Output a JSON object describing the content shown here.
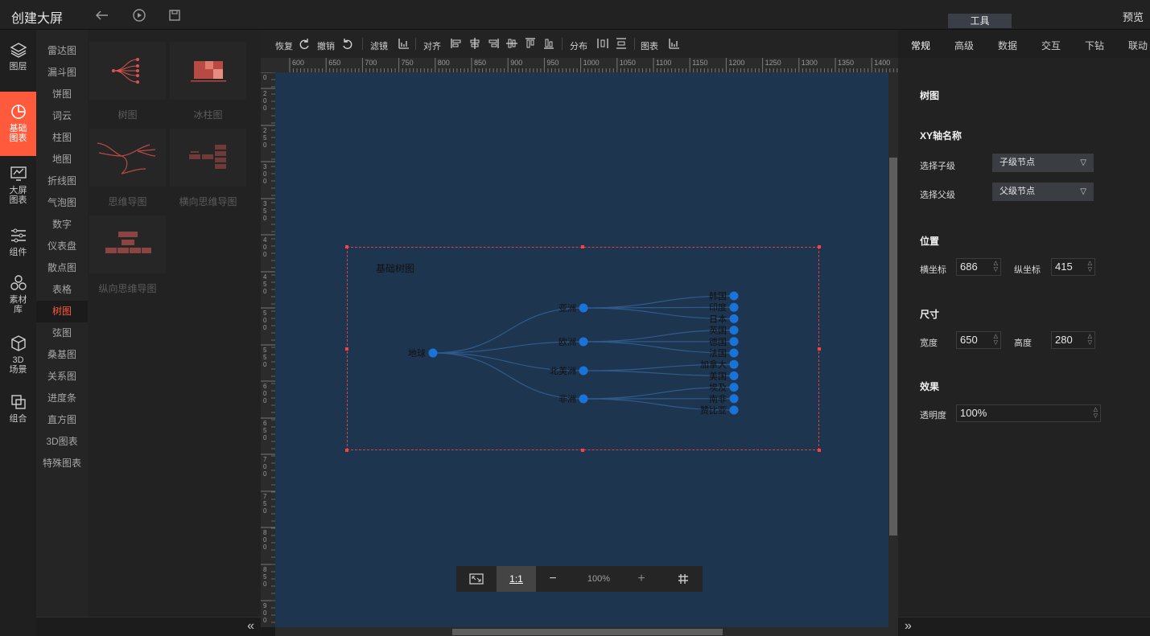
{
  "app": {
    "title": "创建大屏",
    "preview": "预览",
    "tools_tab": "工具"
  },
  "rail": [
    {
      "label": "图层",
      "icon": "layers-icon"
    },
    {
      "label": "基础\n图表",
      "icon": "pie-chart-icon",
      "active": true
    },
    {
      "label": "大屏\n图表",
      "icon": "screen-chart-icon"
    },
    {
      "label": "组件",
      "icon": "sliders-icon"
    },
    {
      "label": "素材\n库",
      "icon": "hexagons-icon"
    },
    {
      "label": "3D\n场景",
      "icon": "cube-icon"
    },
    {
      "label": "组合",
      "icon": "group-icon"
    }
  ],
  "menu2": [
    "雷达图",
    "漏斗图",
    "饼图",
    "词云",
    "柱图",
    "地图",
    "折线图",
    "气泡图",
    "数字",
    "仪表盘",
    "散点图",
    "表格",
    "树图",
    "弦图",
    "桑基图",
    "关系图",
    "进度条",
    "直方图",
    "3D图表",
    "特殊图表"
  ],
  "menu2_active": "树图",
  "cards": [
    {
      "label": "树图"
    },
    {
      "label": "冰柱图"
    },
    {
      "label": "思维导图"
    },
    {
      "label": "横向思维导图"
    },
    {
      "label": "纵向思维导图"
    }
  ],
  "toolbar": {
    "redo": "恢复",
    "undo": "撤销",
    "filter": "滤镜",
    "align": "对齐",
    "distribute": "分布",
    "chart": "图表"
  },
  "ruler_top": [
    "600",
    "650",
    "700",
    "750",
    "800",
    "850",
    "900",
    "950",
    "1000",
    "1050",
    "1100",
    "1150",
    "1200",
    "1250",
    "1300",
    "1350",
    "1400"
  ],
  "ruler_left": [
    "0",
    "200",
    "250",
    "300",
    "350",
    "400",
    "450",
    "500",
    "550",
    "600",
    "650",
    "700",
    "750",
    "800",
    "850",
    "900"
  ],
  "chart": {
    "title": "基础树图",
    "root": "地球",
    "groups": [
      {
        "name": "亚洲",
        "children": [
          "韩国",
          "印度",
          "日本"
        ]
      },
      {
        "name": "欧洲",
        "children": [
          "英国",
          "德国",
          "法国"
        ]
      },
      {
        "name": "北美洲",
        "children": [
          "加拿大",
          "美国"
        ]
      },
      {
        "name": "非洲",
        "children": [
          "埃及",
          "南非",
          "赞比亚"
        ]
      }
    ],
    "node_color": "#1a73d9",
    "link_color": "#2f5b8c"
  },
  "zoom": {
    "ratio": "1:1",
    "minus": "−",
    "value": "100%",
    "plus": "+"
  },
  "rpanel": {
    "tabs": [
      "常规",
      "高级",
      "数据",
      "交互",
      "下钻",
      "联动"
    ],
    "section_chart": "树图",
    "section_xy": "XY轴名称",
    "child_label": "选择子级",
    "child_value": "子级节点",
    "parent_label": "选择父级",
    "parent_value": "父级节点",
    "section_pos": "位置",
    "x_label": "横坐标",
    "x_value": "686",
    "y_label": "纵坐标",
    "y_value": "415",
    "section_size": "尺寸",
    "w_label": "宽度",
    "w_value": "650",
    "h_label": "高度",
    "h_value": "280",
    "section_effect": "效果",
    "opacity_label": "透明度",
    "opacity_value": "100%"
  }
}
